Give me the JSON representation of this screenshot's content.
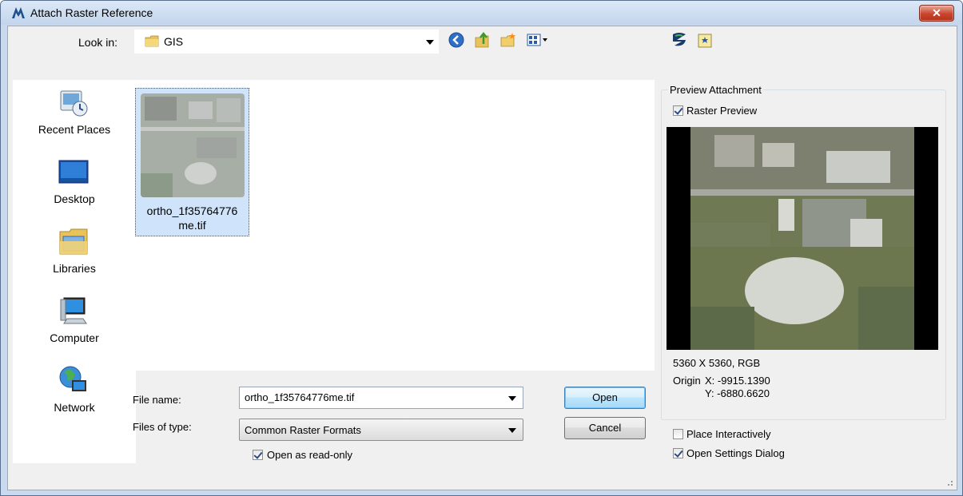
{
  "window": {
    "title": "Attach Raster Reference",
    "close_glyph": "✕"
  },
  "toolbar": {
    "look_in_label": "Look in:",
    "look_in_value": "GIS",
    "icons": [
      "back-icon",
      "up-folder-icon",
      "new-folder-icon",
      "view-menu-icon",
      "raster-manager-icon",
      "favorite-folder-icon"
    ]
  },
  "places": [
    {
      "label": "Recent Places",
      "icon": "recent-places-icon"
    },
    {
      "label": "Desktop",
      "icon": "desktop-icon"
    },
    {
      "label": "Libraries",
      "icon": "libraries-icon"
    },
    {
      "label": "Computer",
      "icon": "computer-icon"
    },
    {
      "label": "Network",
      "icon": "network-icon"
    }
  ],
  "files": [
    {
      "name_line1": "ortho_1f35764776",
      "name_line2": "me.tif",
      "selected": true
    }
  ],
  "form": {
    "file_name_label": "File name:",
    "file_name_value": "ortho_1f35764776me.tif",
    "file_type_label": "Files of type:",
    "file_type_value": "Common Raster Formats",
    "read_only_label": "Open as read-only",
    "read_only_checked": true,
    "open_label": "Open",
    "cancel_label": "Cancel"
  },
  "preview": {
    "group_label": "Preview Attachment",
    "raster_preview_label": "Raster Preview",
    "raster_preview_checked": true,
    "dimensions": "5360 X 5360, RGB",
    "origin_label": "Origin",
    "origin_x": "X: -9915.1390",
    "origin_y": "Y: -6880.6620"
  },
  "options": {
    "place_interactively_label": "Place Interactively",
    "place_interactively_checked": false,
    "open_settings_label": "Open Settings Dialog",
    "open_settings_checked": true
  },
  "colors": {
    "accent": "#3c7fb1",
    "close_red": "#c9452d",
    "selection": "#cfe3fb"
  }
}
